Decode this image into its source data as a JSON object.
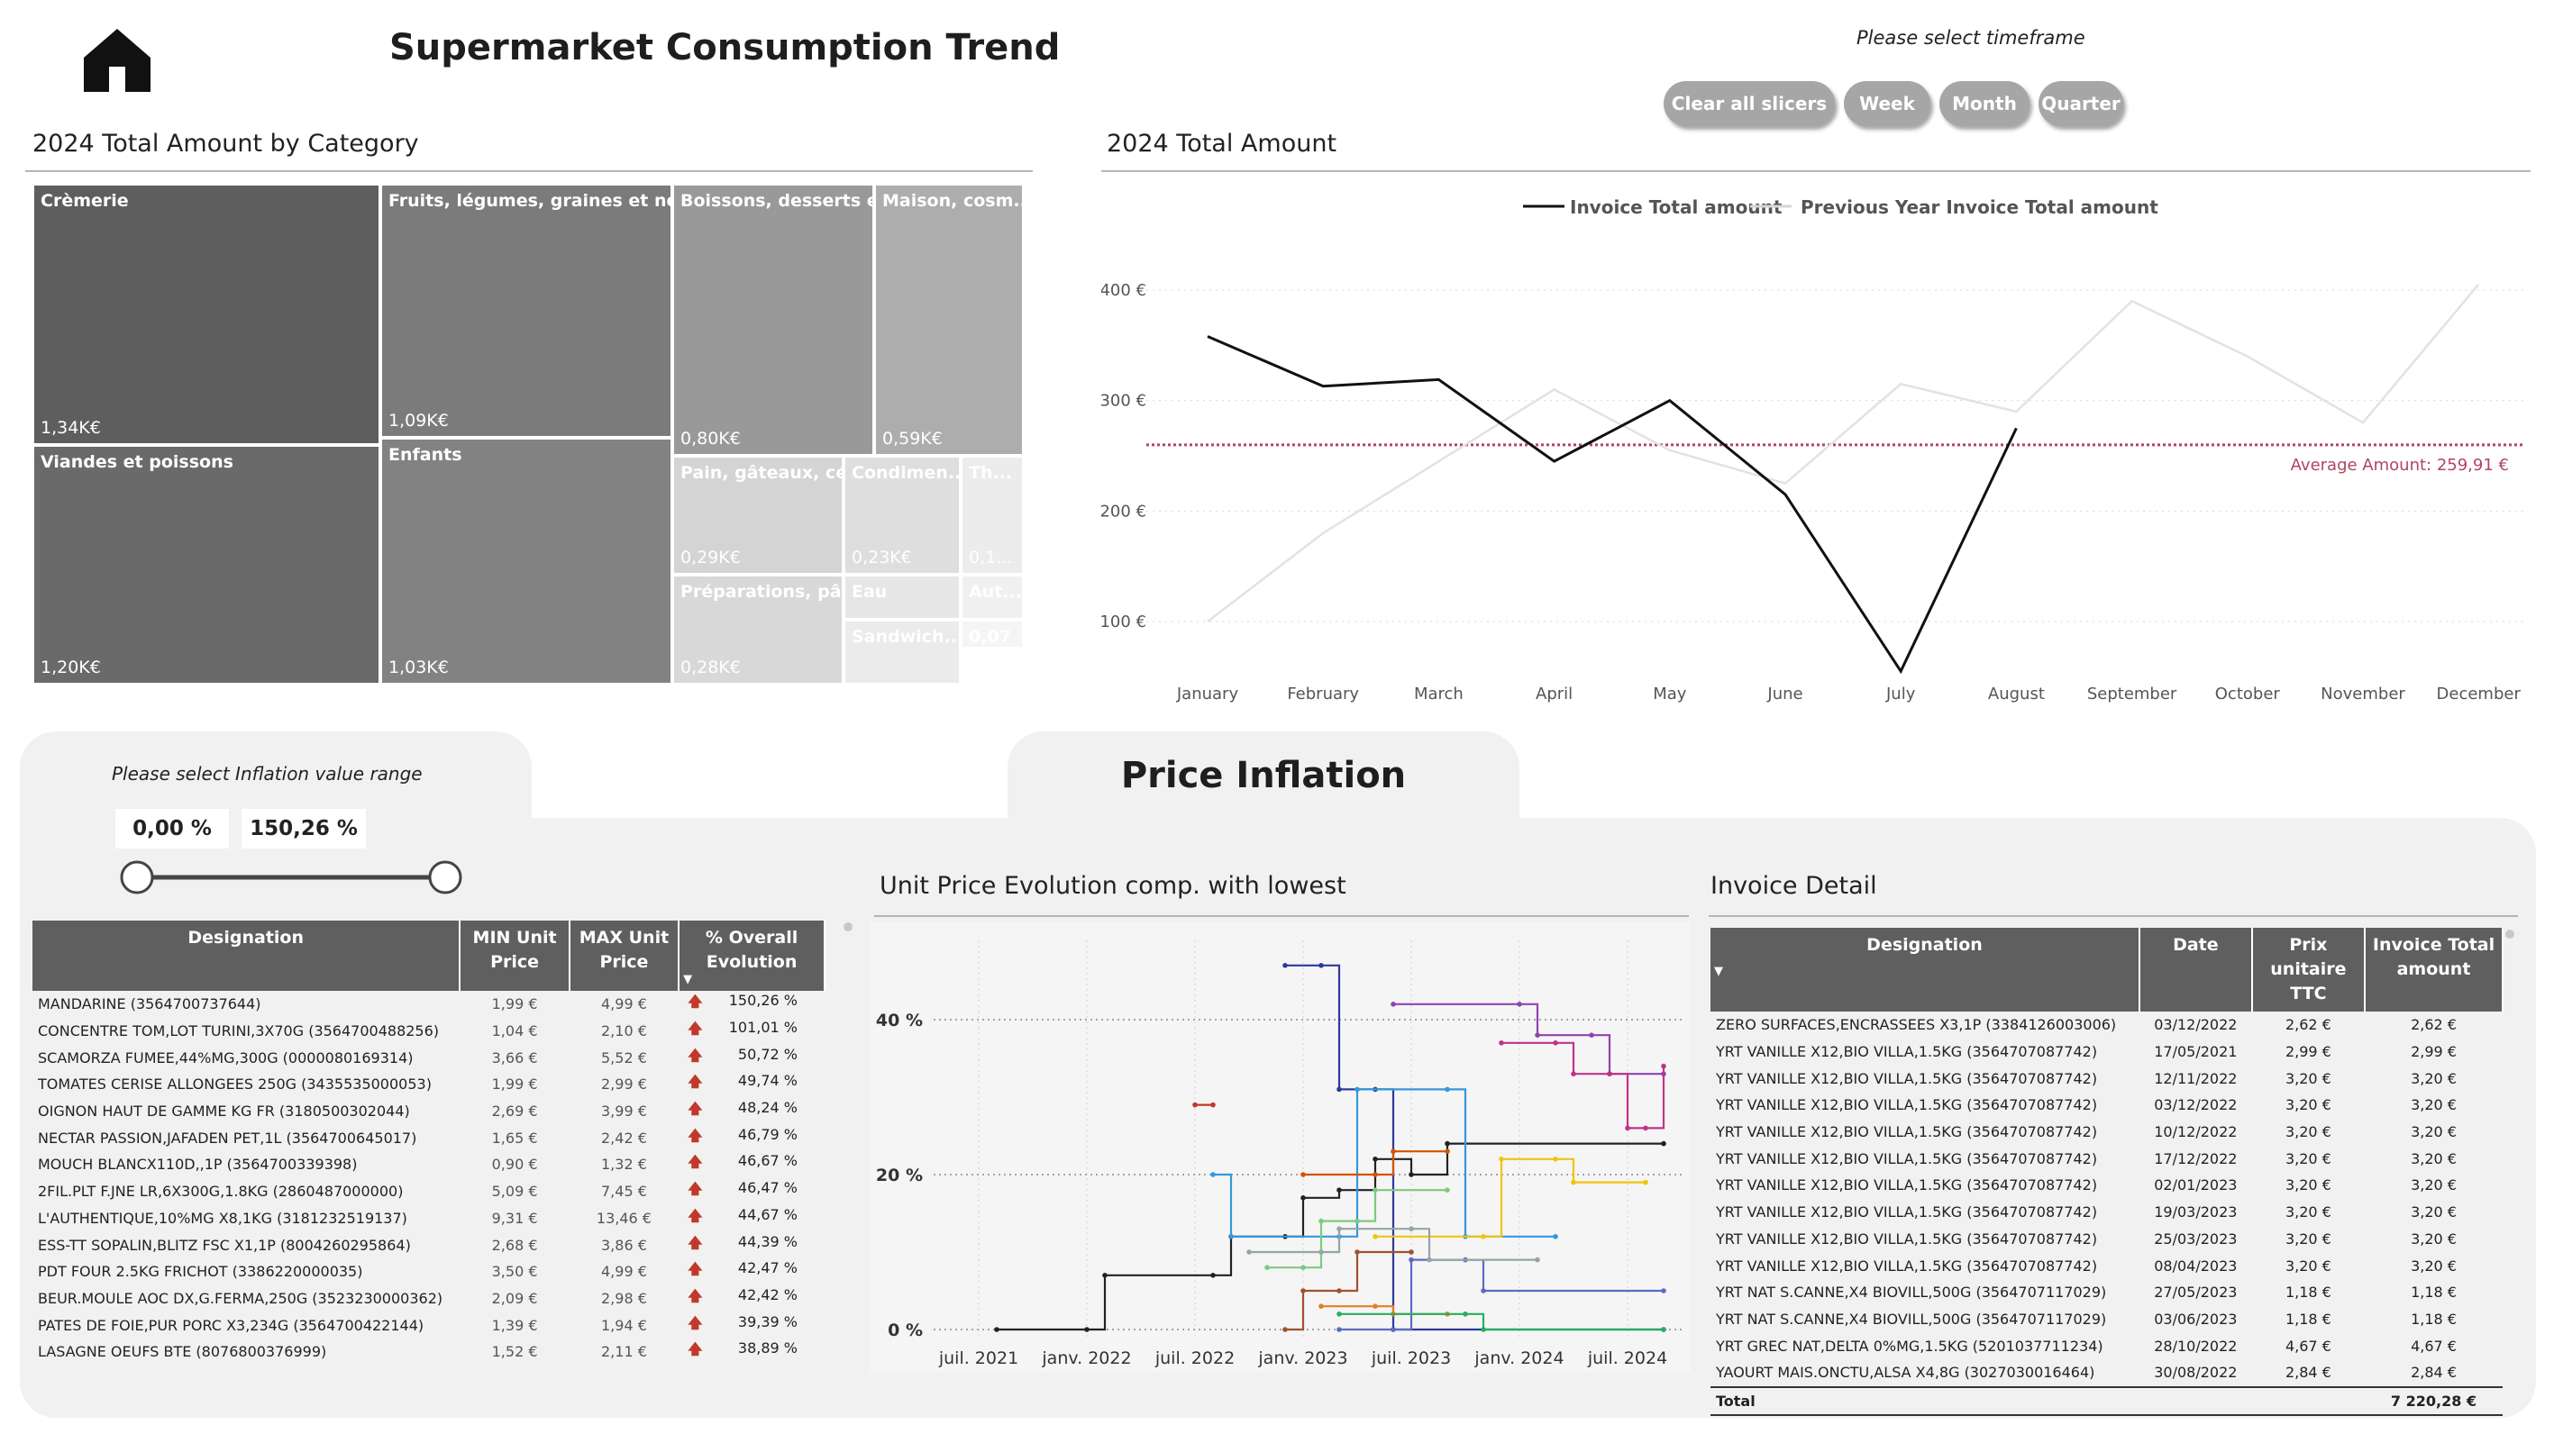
{
  "header": {
    "title": "Supermarket Consumption Trend",
    "timeframe_label": "Please select timeframe"
  },
  "buttons": {
    "clear": "Clear all slicers",
    "week": "Week",
    "month": "Month",
    "quarter": "Quarter"
  },
  "treemap": {
    "title": "2024 Total Amount by Category",
    "cells": [
      {
        "name": "Crèmerie",
        "value": "1,34K€",
        "color": "#5e5e5e"
      },
      {
        "name": "Viandes et poissons",
        "value": "1,20K€",
        "color": "#6a6a6a"
      },
      {
        "name": "Fruits, légumes, graines et noix",
        "value": "1,09K€",
        "color": "#7b7b7b"
      },
      {
        "name": "Enfants",
        "value": "1,03K€",
        "color": "#828282"
      },
      {
        "name": "Boissons, desserts et...",
        "value": "0,80K€",
        "color": "#999999"
      },
      {
        "name": "Maison, cosm...",
        "value": "0,59K€",
        "color": "#adadad"
      },
      {
        "name": "Pain, gâteaux, cé...",
        "value": "0,29K€",
        "color": "#d4d4d4"
      },
      {
        "name": "Condimen...",
        "value": "0,23K€",
        "color": "#dedede"
      },
      {
        "name": "Th...",
        "value": "0,1...",
        "color": "#ececec"
      },
      {
        "name": "Préparations, pâ...",
        "value": "0,28K€",
        "color": "#d8d8d8"
      },
      {
        "name": "Eau",
        "value": "",
        "color": "#e6e6e6"
      },
      {
        "name": "Aut...",
        "value": "",
        "color": "#f0f0f0"
      },
      {
        "name": "Sandwich...",
        "value": "",
        "color": "#ebebeb"
      },
      {
        "name": "0,07",
        "value": "",
        "color": "#f5f5f5"
      }
    ]
  },
  "amount_chart": {
    "title": "2024 Total Amount",
    "legend": [
      "Invoice Total amount",
      "Previous Year Invoice Total amount"
    ],
    "average_label": "Average Amount: 259,91 €",
    "y_ticks": [
      "400 €",
      "300 €",
      "200 €",
      "100 €"
    ]
  },
  "inflation": {
    "section_title": "Price Inflation",
    "range_label": "Please select Inflation value range",
    "range_min": "0,00 %",
    "range_max": "150,26 %",
    "columns": [
      "Designation",
      "MIN Unit Price",
      "MAX Unit Price",
      "% Overall Evolution"
    ],
    "rows": [
      [
        "MANDARINE (3564700737644)",
        "1,99 €",
        "4,99 €",
        "150,26 %"
      ],
      [
        "CONCENTRE TOM,LOT TURINI,3X70G (3564700488256)",
        "1,04 €",
        "2,10 €",
        "101,01 %"
      ],
      [
        "SCAMORZA FUMEE,44%MG,300G (0000080169314)",
        "3,66 €",
        "5,52 €",
        "50,72 %"
      ],
      [
        "TOMATES CERISE ALLONGEES 250G (3435535000053)",
        "1,99 €",
        "2,99 €",
        "49,74 %"
      ],
      [
        "OIGNON HAUT DE GAMME KG FR (3180500302044)",
        "2,69 €",
        "3,99 €",
        "48,24 %"
      ],
      [
        "NECTAR PASSION,JAFADEN PET,1L (3564700645017)",
        "1,65 €",
        "2,42 €",
        "46,79 %"
      ],
      [
        "MOUCH BLANCX110D,,1P (3564700339398)",
        "0,90 €",
        "1,32 €",
        "46,67 %"
      ],
      [
        "2FIL.PLT F.JNE LR,6X300G,1.8KG (2860487000000)",
        "5,09 €",
        "7,45 €",
        "46,47 %"
      ],
      [
        "L'AUTHENTIQUE,10%MG X8,1KG (3181232519137)",
        "9,31 €",
        "13,46 €",
        "44,67 %"
      ],
      [
        "ESS-TT SOPALIN,BLITZ FSC X1,1P (8004260295864)",
        "2,68 €",
        "3,86 €",
        "44,39 %"
      ],
      [
        "PDT FOUR 2.5KG FRICHOT (3386220000035)",
        "3,50 €",
        "4,99 €",
        "42,47 %"
      ],
      [
        "BEUR.MOULE AOC DX,G.FERMA,250G (3523230000362)",
        "2,09 €",
        "2,98 €",
        "42,42 %"
      ],
      [
        "PATES DE FOIE,PUR PORC X3,234G (3564700422144)",
        "1,39 €",
        "1,94 €",
        "39,39 %"
      ],
      [
        "LASAGNE OEUFS BTE (8076800376999)",
        "1,52 €",
        "2,11 €",
        "38,89 %"
      ]
    ]
  },
  "evolution_chart": {
    "title": "Unit Price Evolution comp. with lowest",
    "y_ticks": [
      "40 %",
      "20 %",
      "0 %"
    ],
    "x_ticks": [
      "juil. 2021",
      "janv. 2022",
      "juil. 2022",
      "janv. 2023",
      "juil. 2023",
      "janv. 2024",
      "juil. 2024"
    ]
  },
  "invoice": {
    "title": "Invoice Detail",
    "columns": [
      "Designation",
      "Date",
      "Prix unitaire TTC",
      "Invoice Total amount"
    ],
    "rows": [
      [
        "ZERO SURFACES,ENCRASSEES X3,1P (3384126003006)",
        "03/12/2022",
        "2,62 €",
        "2,62 €"
      ],
      [
        "YRT VANILLE X12,BIO VILLA,1.5KG (3564707087742)",
        "17/05/2021",
        "2,99 €",
        "2,99 €"
      ],
      [
        "YRT VANILLE X12,BIO VILLA,1.5KG (3564707087742)",
        "12/11/2022",
        "3,20 €",
        "3,20 €"
      ],
      [
        "YRT VANILLE X12,BIO VILLA,1.5KG (3564707087742)",
        "03/12/2022",
        "3,20 €",
        "3,20 €"
      ],
      [
        "YRT VANILLE X12,BIO VILLA,1.5KG (3564707087742)",
        "10/12/2022",
        "3,20 €",
        "3,20 €"
      ],
      [
        "YRT VANILLE X12,BIO VILLA,1.5KG (3564707087742)",
        "17/12/2022",
        "3,20 €",
        "3,20 €"
      ],
      [
        "YRT VANILLE X12,BIO VILLA,1.5KG (3564707087742)",
        "02/01/2023",
        "3,20 €",
        "3,20 €"
      ],
      [
        "YRT VANILLE X12,BIO VILLA,1.5KG (3564707087742)",
        "19/03/2023",
        "3,20 €",
        "3,20 €"
      ],
      [
        "YRT VANILLE X12,BIO VILLA,1.5KG (3564707087742)",
        "25/03/2023",
        "3,20 €",
        "3,20 €"
      ],
      [
        "YRT VANILLE X12,BIO VILLA,1.5KG (3564707087742)",
        "08/04/2023",
        "3,20 €",
        "3,20 €"
      ],
      [
        "YRT NAT S.CANNE,X4 BIOVILL,500G (3564707117029)",
        "27/05/2023",
        "1,18 €",
        "1,18 €"
      ],
      [
        "YRT NAT S.CANNE,X4 BIOVILL,500G (3564707117029)",
        "03/06/2023",
        "1,18 €",
        "1,18 €"
      ],
      [
        "YRT GREC NAT,DELTA 0%MG,1.5KG (5201037711234)",
        "28/10/2022",
        "4,67 €",
        "4,67 €"
      ],
      [
        "YAOURT MAIS.ONCTU,ALSA X4,8G (3027030016464)",
        "30/08/2022",
        "2,84 €",
        "2,84 €"
      ]
    ],
    "total_label": "Total",
    "total_value": "7 220,28 €"
  },
  "chart_data": [
    {
      "type": "heatmap",
      "title": "2024 Total Amount by Category",
      "categories": [
        "Crèmerie",
        "Viandes et poissons",
        "Fruits, légumes, graines et noix",
        "Enfants",
        "Boissons, desserts et...",
        "Maison, cosm...",
        "Pain, gâteaux, cé...",
        "Préparations, pâ...",
        "Condimen..."
      ],
      "values": [
        1340,
        1200,
        1090,
        1030,
        800,
        590,
        290,
        280,
        230
      ]
    },
    {
      "type": "line",
      "title": "2024 Total Amount",
      "categories": [
        "January",
        "February",
        "March",
        "April",
        "May",
        "June",
        "July",
        "August",
        "September",
        "October",
        "November",
        "December"
      ],
      "series": [
        {
          "name": "Invoice Total amount",
          "color": "#111111",
          "values": [
            358,
            313,
            319,
            245,
            300,
            215,
            55,
            275,
            null,
            null,
            null,
            null
          ]
        },
        {
          "name": "Previous Year Invoice Total amount",
          "color": "#e2e2e2",
          "values": [
            100,
            180,
            245,
            310,
            255,
            225,
            315,
            290,
            390,
            340,
            280,
            405
          ]
        }
      ],
      "average": 259.91,
      "ylim": [
        50,
        420
      ]
    },
    {
      "type": "line",
      "title": "Unit Price Evolution comp. with lowest",
      "xlim": [
        "2021-05",
        "2024-09"
      ],
      "ylim": [
        0,
        48
      ],
      "series": [
        {
          "color": "#222222",
          "points": [
            [
              "2021-08",
              0
            ],
            [
              "2022-01",
              0
            ],
            [
              "2022-02",
              7
            ],
            [
              "2022-08",
              7
            ],
            [
              "2022-09",
              12
            ],
            [
              "2022-12",
              12
            ],
            [
              "2023-01",
              17
            ],
            [
              "2023-03",
              18
            ],
            [
              "2023-05",
              22
            ],
            [
              "2023-07",
              20
            ],
            [
              "2023-09",
              24
            ],
            [
              "2024-09",
              24
            ]
          ]
        },
        {
          "color": "#2d3a9c",
          "points": [
            [
              "2022-12",
              47
            ],
            [
              "2023-02",
              47
            ],
            [
              "2023-03",
              31
            ],
            [
              "2023-05",
              31
            ],
            [
              "2023-06",
              0
            ],
            [
              "2024-09",
              0
            ]
          ]
        },
        {
          "color": "#8e44ad",
          "points": [
            [
              "2023-06",
              42
            ],
            [
              "2024-01",
              42
            ],
            [
              "2024-02",
              38
            ],
            [
              "2024-05",
              38
            ],
            [
              "2024-06",
              33
            ],
            [
              "2024-09",
              33
            ]
          ]
        },
        {
          "color": "#c0338a",
          "points": [
            [
              "2023-12",
              37
            ],
            [
              "2024-03",
              37
            ],
            [
              "2024-04",
              33
            ],
            [
              "2024-06",
              33
            ],
            [
              "2024-07",
              26
            ],
            [
              "2024-08",
              26
            ],
            [
              "2024-09",
              34
            ]
          ]
        },
        {
          "color": "#3498db",
          "points": [
            [
              "2022-08",
              20
            ],
            [
              "2022-09",
              12
            ],
            [
              "2023-03",
              12
            ],
            [
              "2023-04",
              31
            ],
            [
              "2023-09",
              31
            ],
            [
              "2023-10",
              12
            ],
            [
              "2024-03",
              12
            ]
          ]
        },
        {
          "color": "#f1c40f",
          "points": [
            [
              "2023-05",
              12
            ],
            [
              "2023-11",
              12
            ],
            [
              "2023-12",
              22
            ],
            [
              "2024-03",
              22
            ],
            [
              "2024-04",
              19
            ],
            [
              "2024-08",
              19
            ]
          ]
        },
        {
          "color": "#7fc97f",
          "points": [
            [
              "2022-11",
              8
            ],
            [
              "2023-01",
              8
            ],
            [
              "2023-02",
              14
            ],
            [
              "2023-04",
              14
            ],
            [
              "2023-05",
              18
            ],
            [
              "2023-09",
              18
            ]
          ]
        },
        {
          "color": "#a0522d",
          "points": [
            [
              "2022-12",
              0
            ],
            [
              "2023-01",
              5
            ],
            [
              "2023-03",
              5
            ],
            [
              "2023-04",
              10
            ],
            [
              "2023-07",
              10
            ]
          ]
        },
        {
          "color": "#5c6bc0",
          "points": [
            [
              "2023-03",
              0
            ],
            [
              "2023-06",
              0
            ],
            [
              "2023-07",
              9
            ],
            [
              "2023-10",
              9
            ],
            [
              "2023-11",
              5
            ],
            [
              "2024-09",
              5
            ]
          ]
        },
        {
          "color": "#e67e22",
          "points": [
            [
              "2023-02",
              3
            ],
            [
              "2023-05",
              3
            ],
            [
              "2023-06",
              2
            ],
            [
              "2023-09",
              2
            ]
          ]
        },
        {
          "color": "#27ae60",
          "points": [
            [
              "2023-03",
              2
            ],
            [
              "2023-10",
              2
            ],
            [
              "2023-11",
              0
            ],
            [
              "2024-09",
              0
            ]
          ]
        },
        {
          "color": "#95a5a6",
          "points": [
            [
              "2022-10",
              10
            ],
            [
              "2023-02",
              10
            ],
            [
              "2023-03",
              13
            ],
            [
              "2023-07",
              13
            ],
            [
              "2023-08",
              9
            ],
            [
              "2024-02",
              9
            ]
          ]
        },
        {
          "color": "#d35400",
          "points": [
            [
              "2023-01",
              20
            ],
            [
              "2023-05",
              20
            ],
            [
              "2023-06",
              23
            ],
            [
              "2023-09",
              23
            ]
          ]
        },
        {
          "color": "#c0392b",
          "points": [
            [
              "2022-07",
              29
            ],
            [
              "2022-08",
              29
            ]
          ]
        }
      ]
    }
  ]
}
